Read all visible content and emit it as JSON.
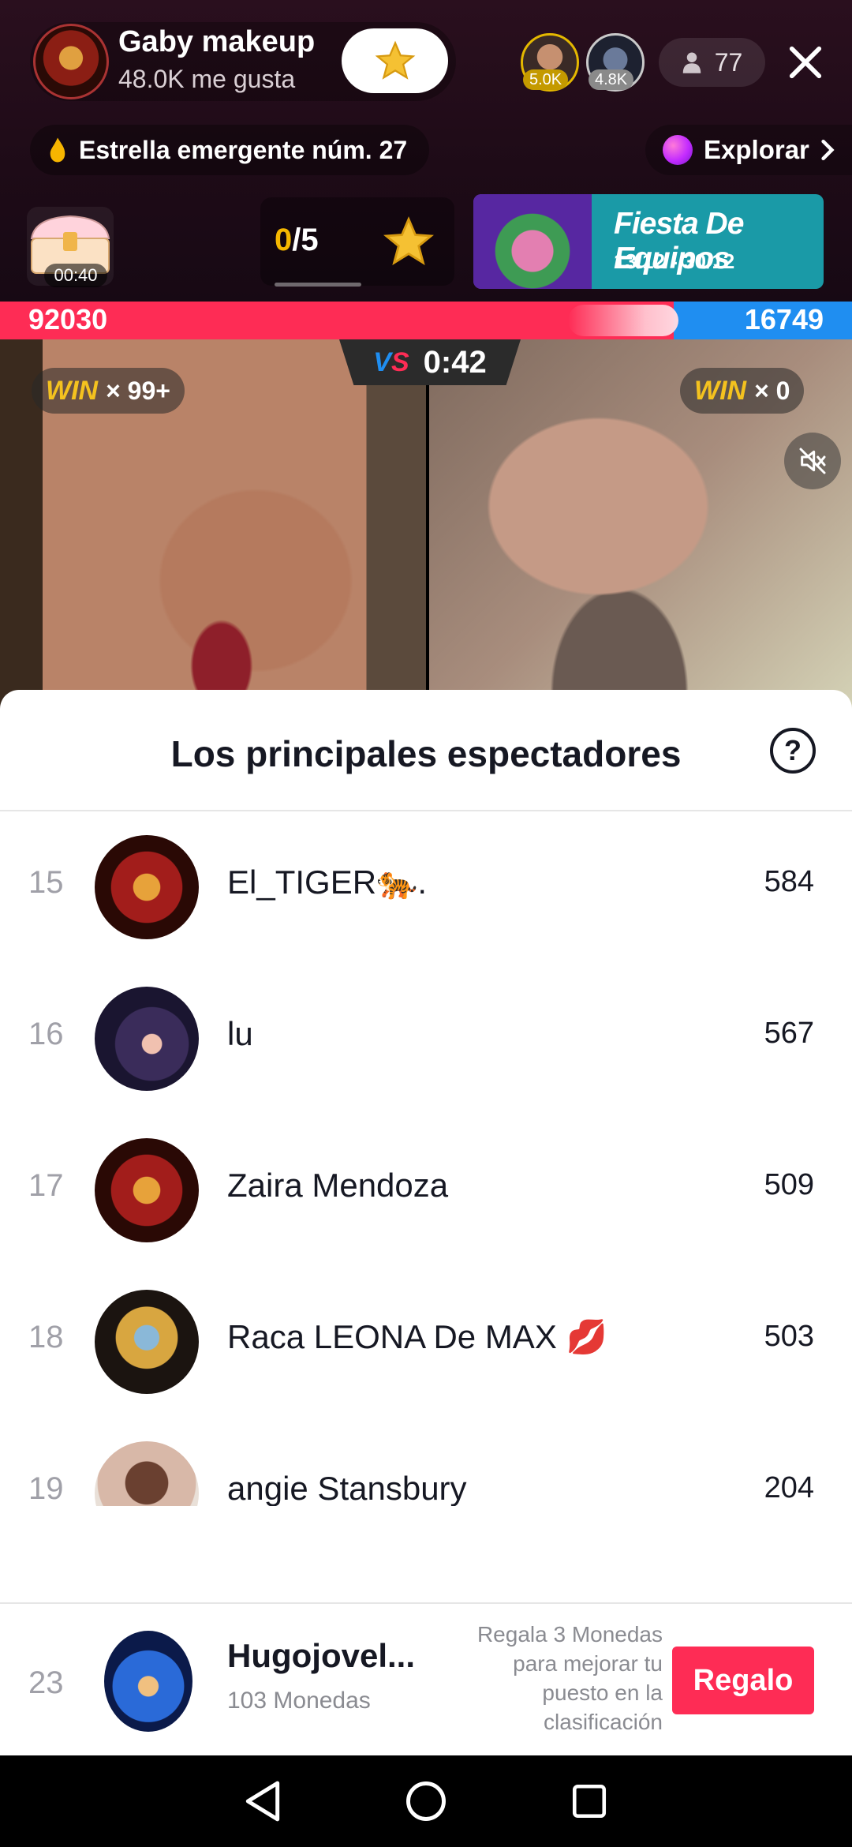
{
  "header": {
    "host_name": "Gaby makeup",
    "host_likes": "48.0K me gusta",
    "top_viewers": [
      {
        "badge": "5.0K"
      },
      {
        "badge": "4.8K"
      }
    ],
    "viewer_count": "77",
    "rising_star": "Estrella emergente núm. 27",
    "explore": "Explorar",
    "chest_timer": "00:40",
    "quest_done": "0",
    "quest_total": "/5",
    "banner_title": "Fiesta De Equipos",
    "banner_date": "13/12 - 30/12"
  },
  "battle": {
    "score_left": "92030",
    "score_right": "16749",
    "timer": "0:42",
    "vs": "VS",
    "left_win_word": "WIN",
    "left_win_count": "× 99+",
    "right_win_word": "WIN",
    "right_win_count": "× 0"
  },
  "sheet": {
    "title": "Los principales espectadores",
    "help": "?",
    "rows": [
      {
        "rank": "15",
        "name": "El_TIGER🐅.",
        "score": "584"
      },
      {
        "rank": "16",
        "name": "lu",
        "score": "567"
      },
      {
        "rank": "17",
        "name": "Zaira Mendoza",
        "score": "509"
      },
      {
        "rank": "18",
        "name": "Raca LEONA De MAX 💋",
        "score": "503"
      },
      {
        "rank": "19",
        "name": "angie Stansbury",
        "score": "204"
      }
    ]
  },
  "my_rank": {
    "rank": "23",
    "name": "Hugojovel...",
    "coins": "103 Monedas",
    "hint": "Regala 3 Monedas para mejorar tu puesto en la clasificación",
    "gift_button": "Regalo"
  },
  "colors": {
    "accent_red": "#fe2c55",
    "accent_blue": "#1f8ef1",
    "gold": "#f4c21f"
  }
}
